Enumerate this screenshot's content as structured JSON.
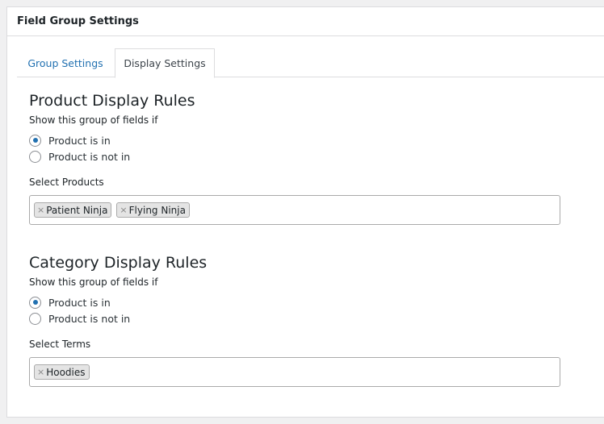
{
  "panel": {
    "title": "Field Group Settings"
  },
  "tabs": [
    {
      "label": "Group Settings"
    },
    {
      "label": "Display Settings"
    }
  ],
  "product_rules": {
    "heading": "Product Display Rules",
    "description": "Show this group of fields if",
    "options": [
      {
        "label": "Product is in",
        "checked": true
      },
      {
        "label": "Product is not in",
        "checked": false
      }
    ],
    "field_label": "Select Products",
    "selected": [
      {
        "remove": "×",
        "label": "Patient Ninja"
      },
      {
        "remove": "×",
        "label": "Flying Ninja"
      }
    ]
  },
  "category_rules": {
    "heading": "Category Display Rules",
    "description": "Show this group of fields if",
    "options": [
      {
        "label": "Product is in",
        "checked": true
      },
      {
        "label": "Product is not in",
        "checked": false
      }
    ],
    "field_label": "Select Terms",
    "selected": [
      {
        "remove": "×",
        "label": "Hoodies"
      }
    ]
  },
  "colors": {
    "accent": "#2271b1",
    "border": "#dcdcde",
    "background": "#f0f0f1"
  }
}
